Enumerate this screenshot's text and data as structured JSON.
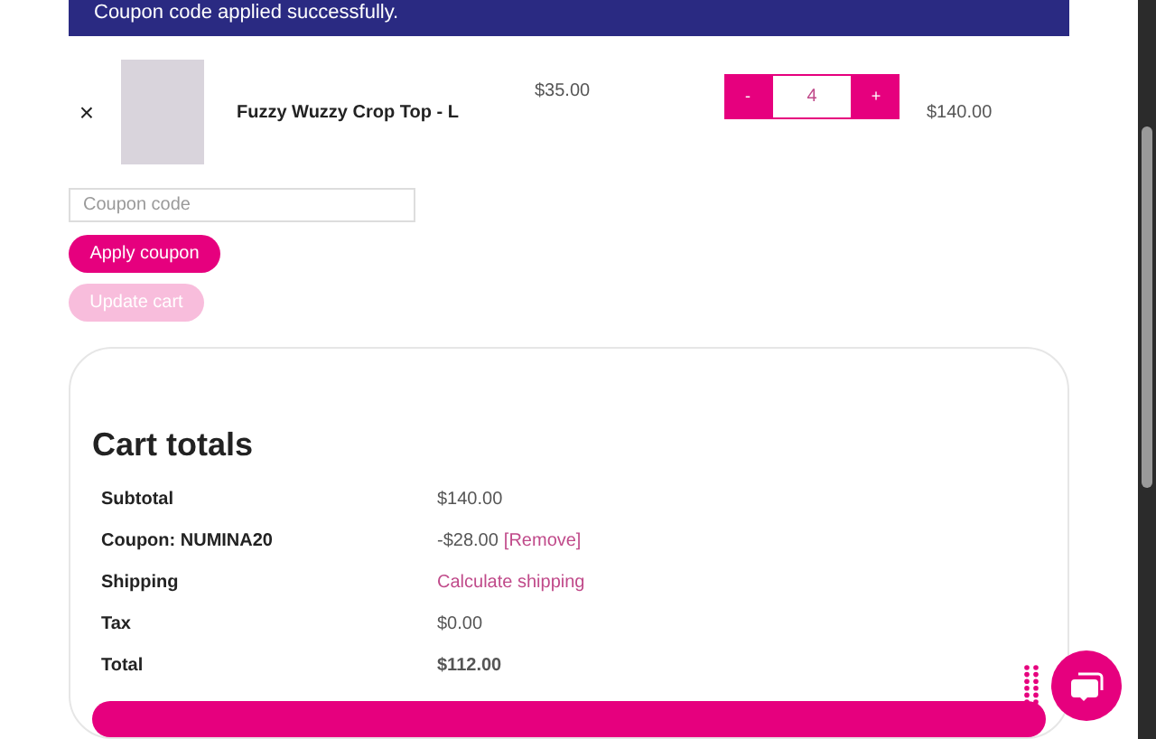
{
  "notice": {
    "text": "Coupon code applied successfully."
  },
  "cart_item": {
    "remove": "×",
    "name": "Fuzzy Wuzzy Crop Top - L",
    "price": "$35.00",
    "minus": "-",
    "quantity": "4",
    "plus": "+",
    "subtotal": "$140.00"
  },
  "coupon": {
    "placeholder": "Coupon code",
    "apply": "Apply coupon",
    "update": "Update cart",
    "update_disabled": true
  },
  "totals": {
    "title": "Cart totals",
    "rows": [
      {
        "kind": "plain",
        "label": "Subtotal",
        "value": "$140.00"
      },
      {
        "kind": "coupon",
        "label": "Coupon: NUMINA20",
        "value": "-$28.00",
        "link": "[Remove]"
      },
      {
        "kind": "link",
        "label": "Shipping",
        "value": "Calculate shipping"
      },
      {
        "kind": "plain",
        "label": "Tax",
        "value": "$0.00"
      },
      {
        "kind": "bold",
        "label": "Total",
        "value": "$112.00"
      }
    ]
  }
}
